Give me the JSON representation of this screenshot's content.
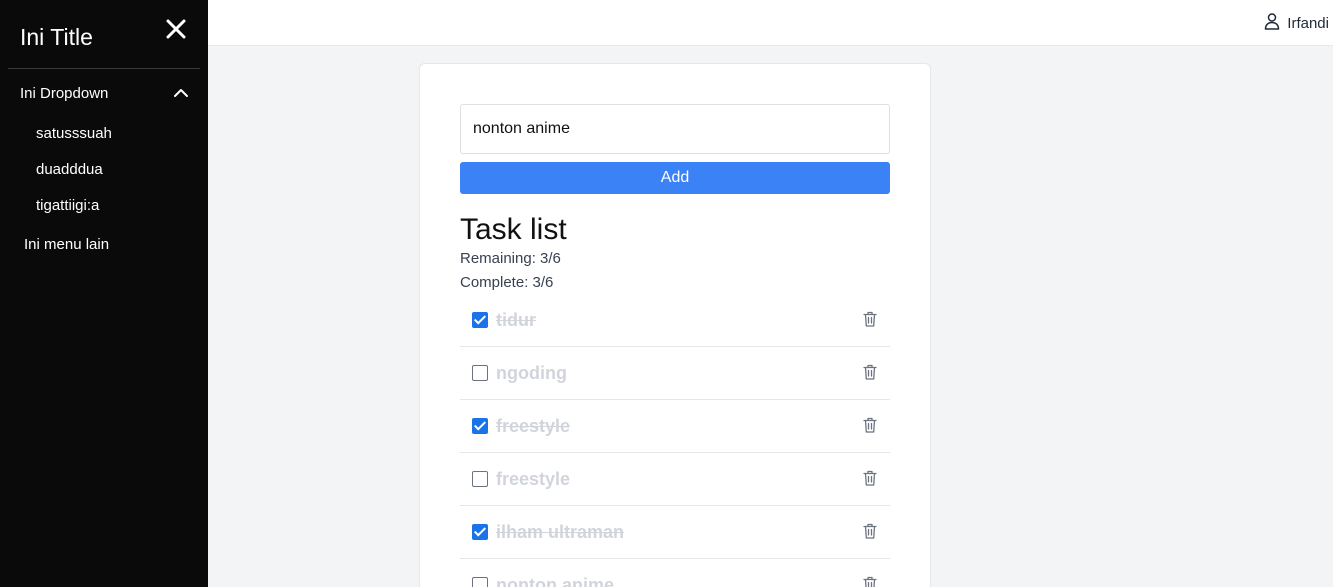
{
  "sidebar": {
    "title": "Ini Title",
    "dropdown": {
      "label": "Ini Dropdown",
      "items": [
        "satusssuah",
        "duadddua",
        "tigattiigi:a"
      ]
    },
    "other_menu": "Ini menu lain"
  },
  "topbar": {
    "user_name": "Irfandi"
  },
  "form": {
    "input_value": "nonton anime",
    "add_label": "Add"
  },
  "tasks": {
    "heading": "Task list",
    "remaining": "Remaining: 3/6",
    "complete": "Complete: 3/6",
    "items": [
      {
        "text": "tidur",
        "done": true
      },
      {
        "text": "ngoding",
        "done": false
      },
      {
        "text": "freestyle",
        "done": true
      },
      {
        "text": "freestyle",
        "done": false
      },
      {
        "text": "ilham ultraman",
        "done": true
      },
      {
        "text": "nonton anime",
        "done": false
      }
    ]
  },
  "colors": {
    "sidebar_bg": "#0a0a0a",
    "accent": "#3b82f6",
    "checkbox_checked": "#1a73e8"
  },
  "icons": [
    "close-icon",
    "chevron-up-icon",
    "user-icon",
    "trash-icon"
  ]
}
